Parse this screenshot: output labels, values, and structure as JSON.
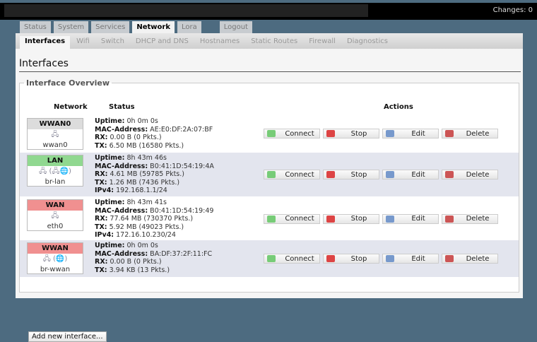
{
  "header": {
    "changes": "Changes: 0"
  },
  "tabs": [
    "Status",
    "System",
    "Services",
    "Network",
    "Lora",
    "Logout"
  ],
  "subtabs": [
    "Interfaces",
    "Wifi",
    "Switch",
    "DHCP and DNS",
    "Hostnames",
    "Static Routes",
    "Firewall",
    "Diagnostics"
  ],
  "page_title": "Interfaces",
  "section": "Interface Overview",
  "columns": {
    "network": "Network",
    "status": "Status",
    "actions": "Actions"
  },
  "action_labels": {
    "connect": "Connect",
    "stop": "Stop",
    "edit": "Edit",
    "delete": "Delete"
  },
  "labels": {
    "uptime": "Uptime:",
    "mac": "MAC-Address:",
    "rx": "RX:",
    "tx": "TX:",
    "ipv4": "IPv4:"
  },
  "interfaces": [
    {
      "name": "WWAN0",
      "color": "#dcdcdc",
      "icons": "🖧",
      "device": "wwan0",
      "uptime": "0h 0m 0s",
      "mac": "AE:E0:DF:2A:07:BF",
      "rx": "0.00 B (0 Pkts.)",
      "tx": "6.50 MB (16580 Pkts.)"
    },
    {
      "name": "LAN",
      "color": "#90d890",
      "icons": "🖧 (🖧🌐)",
      "device": "br-lan",
      "uptime": "8h 43m 46s",
      "mac": "B0:41:1D:54:19:4A",
      "rx": "4.61 MB (59785 Pkts.)",
      "tx": "1.26 MB (7436 Pkts.)",
      "ipv4": "192.168.1.1/24"
    },
    {
      "name": "WAN",
      "color": "#f09090",
      "icons": "🖧",
      "device": "eth0",
      "uptime": "8h 43m 41s",
      "mac": "B0:41:1D:54:19:49",
      "rx": "77.64 MB (730370 Pkts.)",
      "tx": "5.92 MB (49023 Pkts.)",
      "ipv4": "172.16.10.230/24"
    },
    {
      "name": "WWAN",
      "color": "#f09090",
      "icons": "🖧 (🌐)",
      "device": "br-wwan",
      "uptime": "0h 0m 0s",
      "mac": "BA:DF:37:2F:11:FC",
      "rx": "0.00 B (0 Pkts.)",
      "tx": "3.94 KB (13 Pkts.)"
    }
  ],
  "add_button": "Add new interface..."
}
